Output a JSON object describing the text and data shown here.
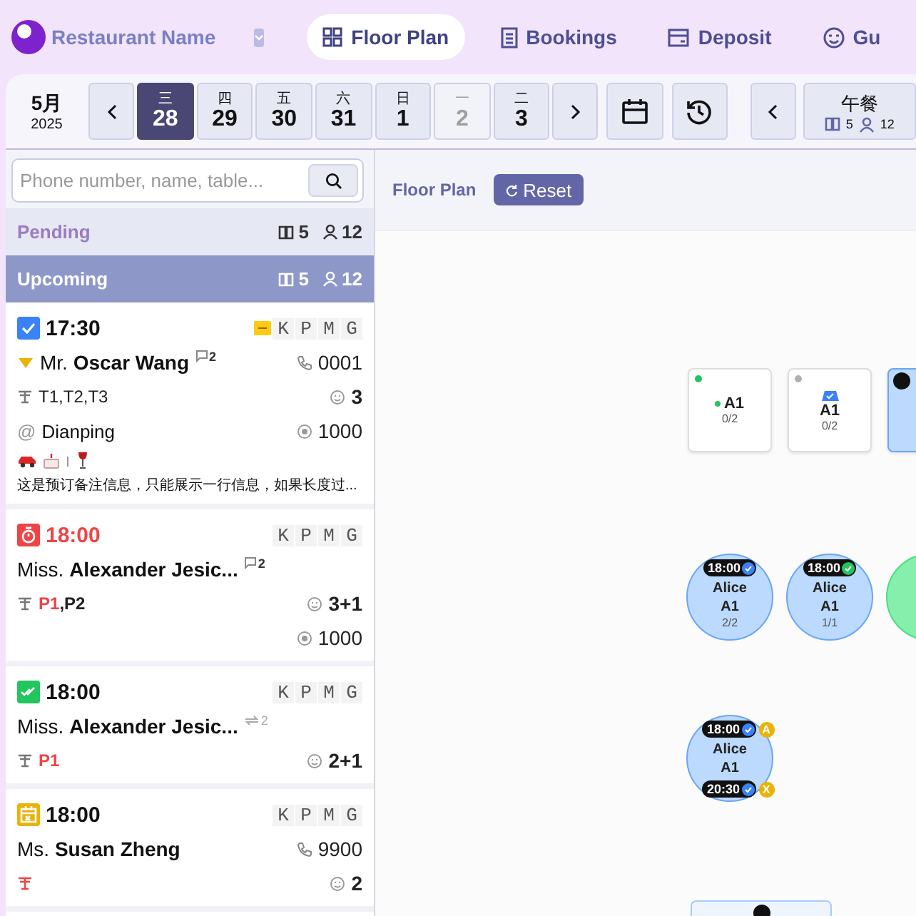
{
  "brand": {
    "name": "Restaurant Name"
  },
  "nav_tabs": [
    {
      "label": "Floor Plan",
      "selected": true
    },
    {
      "label": "Bookings",
      "selected": false
    },
    {
      "label": "Deposit",
      "selected": false
    },
    {
      "label": "Gu",
      "selected": false
    }
  ],
  "date_bar": {
    "month": "5月",
    "year": "2025",
    "days": [
      {
        "weekday": "三",
        "day": "28",
        "selected": true,
        "disabled": false
      },
      {
        "weekday": "四",
        "day": "29",
        "selected": false,
        "disabled": false
      },
      {
        "weekday": "五",
        "day": "30",
        "selected": false,
        "disabled": false
      },
      {
        "weekday": "六",
        "day": "31",
        "selected": false,
        "disabled": false
      },
      {
        "weekday": "日",
        "day": "1",
        "selected": false,
        "disabled": false
      },
      {
        "weekday": "一",
        "day": "2",
        "selected": false,
        "disabled": true
      },
      {
        "weekday": "二",
        "day": "3",
        "selected": false,
        "disabled": false
      }
    ],
    "meal": {
      "label": "午餐",
      "bookings": "5",
      "guests": "12"
    }
  },
  "search": {
    "placeholder": "Phone number, name, table..."
  },
  "groups": [
    {
      "label": "Pending",
      "bookings": "5",
      "guests": "12",
      "selected": false
    },
    {
      "label": "Upcoming",
      "bookings": "5",
      "guests": "12",
      "selected": true
    }
  ],
  "bookings": [
    {
      "kind": "checked",
      "time": "17:30",
      "late": false,
      "pos": true,
      "letters": [
        "K",
        "P",
        "M",
        "G"
      ],
      "guest": "Mr. **Oscar Wang**",
      "badge": {
        "kind": "comment",
        "count": "2"
      },
      "phone": "0001",
      "tables": [
        {
          "label": "T1",
          "overdue": false
        },
        {
          "label": "T2",
          "overdue": false
        },
        {
          "label": "T3",
          "overdue": false
        }
      ],
      "table_separator": ",",
      "unassigned": false,
      "guests": "3",
      "source_mark": "@",
      "source": "Dianping",
      "deposit": "1000",
      "tags": [
        {
          "kind": "car"
        },
        {
          "kind": "cake"
        },
        {
          "kind": "divider"
        },
        {
          "kind": "wine"
        }
      ],
      "note": "这是预订备注信息，只能展示一行信息，如果长度过..."
    },
    {
      "kind": "timer",
      "time": "18:00",
      "late": true,
      "pos": false,
      "letters": [
        "K",
        "P",
        "M",
        "G"
      ],
      "guest": "Miss. **Alexander Jesic...**",
      "badge": {
        "kind": "comment",
        "count": "2"
      },
      "tables": [
        {
          "label": "P1",
          "overdue": true
        },
        {
          "label": "P2",
          "overdue": false
        }
      ],
      "table_separator": ",",
      "unassigned": false,
      "guests": "3+1",
      "deposit": "1000"
    },
    {
      "kind": "confirmed",
      "time": "18:00",
      "late": false,
      "pos": false,
      "letters": [
        "K",
        "P",
        "M",
        "G"
      ],
      "guest": "Miss. **Alexander Jesic...**",
      "badge": {
        "kind": "transfer",
        "count": "2"
      },
      "tables": [
        {
          "label": "P1",
          "overdue": true
        }
      ],
      "unassigned": false,
      "guests": "2+1"
    },
    {
      "kind": "calendar",
      "time": "18:00",
      "late": false,
      "pos": false,
      "letters": [
        "K",
        "P",
        "M",
        "G"
      ],
      "guest": "Ms. **Susan Zheng**",
      "phone": "9900",
      "unassigned": true,
      "guests": "2"
    }
  ],
  "floor": {
    "title": "Floor Plan",
    "reset": "Reset",
    "tables": [
      {
        "kind": "square",
        "occupied": false,
        "arrived": false,
        "color": "#22c55e",
        "label": "A1",
        "label_dot": true,
        "seats": "0/2"
      },
      {
        "kind": "square",
        "occupied": false,
        "arrived": false,
        "color": "#b0b0b0",
        "booked": true,
        "label": "A1",
        "seats": "0/2"
      },
      {
        "kind": "square",
        "occupied": true,
        "arrived": false,
        "badge_only": true
      },
      {
        "kind": "round",
        "occupied": true,
        "arrived": false,
        "time": "18:00",
        "confirmed": false,
        "name": "Alice",
        "label": "A1",
        "seats": "2/2"
      },
      {
        "kind": "round",
        "occupied": true,
        "arrived": false,
        "time": "18:00",
        "confirmed": true,
        "name": "Alice",
        "label": "A1",
        "seats": "1/1"
      },
      {
        "kind": "round",
        "occupied": true,
        "arrived": true
      },
      {
        "kind": "round",
        "occupied": true,
        "arrived": false,
        "time": "18:00",
        "confirmed": false,
        "time_flag": "A",
        "name": "Alice",
        "label": "A1",
        "end_time": "20:30",
        "end_flag": "X"
      },
      {
        "kind": "rect",
        "occupied": false,
        "arrived": false,
        "badge_only": true
      }
    ]
  }
}
